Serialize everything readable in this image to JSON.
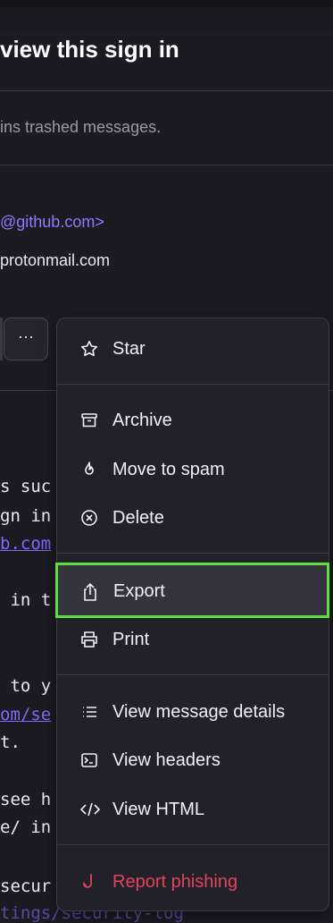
{
  "email": {
    "title_fragment": "view this sign in",
    "notice_fragment": "ins trashed messages.",
    "sender_fragment": "@github.com>",
    "recipient_fragment": "protonmail.com",
    "more_button": "···",
    "body_lines": [
      "s suc",
      "gn in",
      "b.com",
      " in t",
      " to y",
      "om/se",
      "t.",
      "see h",
      "e/ in",
      "secur",
      "tings/security-log"
    ]
  },
  "menu": {
    "items": [
      {
        "label": "Star",
        "icon": "star-icon"
      },
      {
        "label": "Archive",
        "icon": "archive-icon"
      },
      {
        "label": "Move to spam",
        "icon": "fire-icon"
      },
      {
        "label": "Delete",
        "icon": "circle-x-icon"
      },
      {
        "label": "Export",
        "icon": "share-icon"
      },
      {
        "label": "Print",
        "icon": "printer-icon"
      },
      {
        "label": "View message details",
        "icon": "list-icon"
      },
      {
        "label": "View headers",
        "icon": "terminal-icon"
      },
      {
        "label": "View HTML",
        "icon": "code-icon"
      },
      {
        "label": "Report phishing",
        "icon": "hook-icon"
      }
    ],
    "selected": "Export",
    "accent_color": "#5ee03a",
    "danger_color": "#e0455a"
  }
}
